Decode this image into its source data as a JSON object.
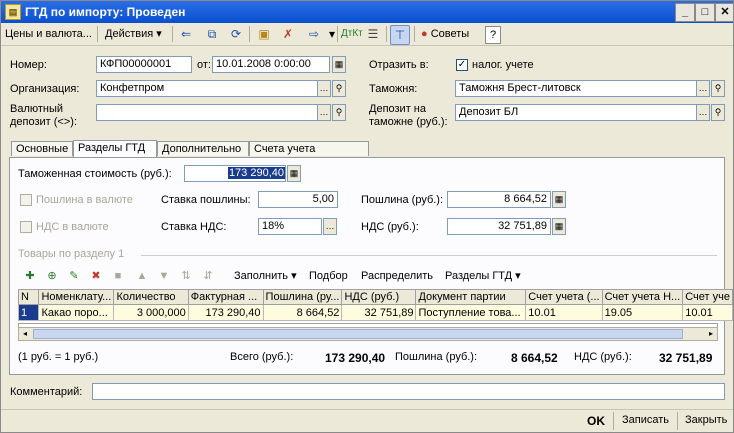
{
  "window": {
    "title": "ГТД по импорту: Проведен"
  },
  "toolbar": {
    "prices_label": "Цены и валюта...",
    "actions_label": "Действия",
    "tips_label": "Советы",
    "help_label": "?"
  },
  "header": {
    "number_label": "Номер:",
    "number_value": "КФП00000001",
    "date_label": "от:",
    "date_value": "10.01.2008  0:00:00",
    "reflect_label": "Отразить в:",
    "tax_label": "налог. учете",
    "org_label": "Организация:",
    "org_value": "Конфетпром",
    "customs_label": "Таможня:",
    "customs_value": "Таможня Брест-литовск",
    "currency_deposit_label": "Валютный\nдепозит (<>):",
    "customs_deposit_label": "Депозит на\nтаможне (руб.):",
    "customs_deposit_value": "Депозит БЛ"
  },
  "tabs": [
    "Основные",
    "Разделы ГТД",
    "Дополнительно",
    "Счета учета расчетов"
  ],
  "section": {
    "customs_value_label": "Таможенная стоимость (руб.):",
    "customs_value": "173 290,40",
    "duty_in_currency_label": "Пошлина в валюте",
    "vat_in_currency_label": "НДС в валюте",
    "duty_rate_label": "Ставка пошлины:",
    "duty_rate_value": "5,00",
    "vat_rate_label": "Ставка НДС:",
    "vat_rate_value": "18%",
    "duty_label": "Пошлина (руб.):",
    "duty_value": "8 664,52",
    "vat_label": "НДС (руб.):",
    "vat_value": "32 751,89",
    "goods_title": "Товары по разделу 1"
  },
  "grid_toolbar": {
    "fill_label": "Заполнить",
    "select_label": "Подбор",
    "distribute_label": "Распределить",
    "sections_label": "Разделы ГТД"
  },
  "grid": {
    "columns": [
      "N",
      "Номенклату...",
      "Количество",
      "Фактурная ...",
      "Пошлина (ру...",
      "НДС (руб.)",
      "Документ партии",
      "Счет учета (...",
      "Счет учета Н...",
      "Счет уче"
    ],
    "rows": [
      [
        "1",
        "Какао поро...",
        "3 000,000",
        "173 290,40",
        "8 664,52",
        "32 751,89",
        "Поступление това...",
        "10.01",
        "19.05",
        "10.01"
      ]
    ]
  },
  "totals": {
    "rate_note": "(1 руб. = 1 руб.)",
    "total_label": "Всего (руб.):",
    "total_value": "173 290,40",
    "duty_label": "Пошлина (руб.):",
    "duty_value": "8 664,52",
    "vat_label": "НДС (руб.):",
    "vat_value": "32 751,89"
  },
  "comment_label": "Комментарий:",
  "bottom": {
    "ok_label": "OK",
    "save_label": "Записать",
    "close_label": "Закрыть"
  }
}
